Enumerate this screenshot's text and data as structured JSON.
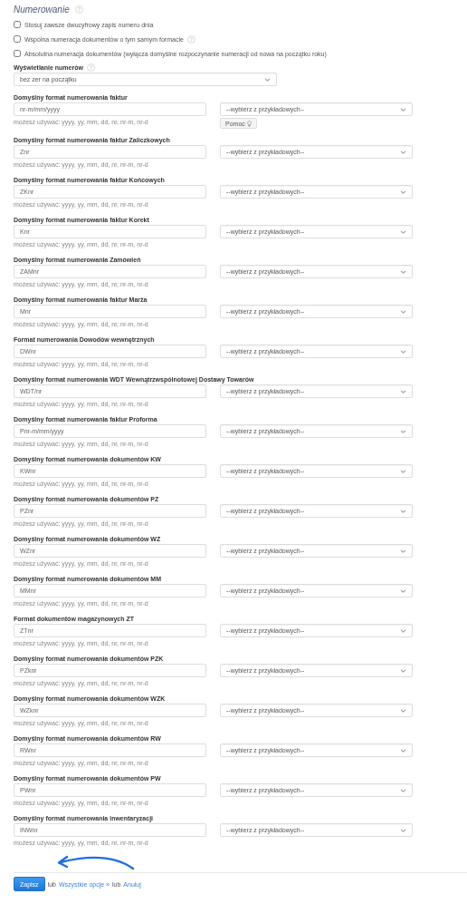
{
  "section": {
    "title": "Numerowanie",
    "help": true
  },
  "options": [
    {
      "label": "Stosuj zawsze dwucyfrowy zapis numeru dnia",
      "checked": false,
      "help": false
    },
    {
      "label": "Wspólna numeracja dokumentów o tym samym formacie",
      "checked": false,
      "help": true
    },
    {
      "label": "Absolutna numeracja dokumentów (wyłącza domyślne rozpoczynanie numeracji od nowa na początku roku)",
      "checked": false,
      "help": false
    }
  ],
  "display": {
    "label": "Wyświetlanie numerów",
    "help": true,
    "value": "bez zer na początku"
  },
  "formats": [
    {
      "label": "Domyślny format numerowania faktur",
      "value": "nr-m/mm/yyyy",
      "select": "--wybierz z przykładowych--",
      "hint": "możesz używać: yyyy, yy, mm, dd, nr, nr-m, nr-d",
      "help_button": "Pomoc"
    },
    {
      "label": "Domyślny format numerowania faktur Zaliczkowych",
      "value": "Znr",
      "select": "--wybierz z przykładowych--",
      "hint": "możesz używać: yyyy, yy, mm, dd, nr, nr-m, nr-d"
    },
    {
      "label": "Domyślny format numerowania faktur Końcowych",
      "value": "ZKnr",
      "select": "--wybierz z przykładowych--",
      "hint": "możesz używać: yyyy, yy, mm, dd, nr, nr-m, nr-d"
    },
    {
      "label": "Domyślny format numerowania faktur Korekt",
      "value": "Knr",
      "select": "--wybierz z przykładowych--",
      "hint": "możesz używać: yyyy, yy, mm, dd, nr, nr-m, nr-d"
    },
    {
      "label": "Domyślny format numerowania Zamówień",
      "value": "ZAMnr",
      "select": "--wybierz z przykładowych--",
      "hint": "możesz używać: yyyy, yy, mm, dd, nr, nr-m, nr-d"
    },
    {
      "label": "Domyślny format numerowania faktur Marża",
      "value": "Mnr",
      "select": "--wybierz z przykładowych--",
      "hint": "możesz używać: yyyy, yy, mm, dd, nr, nr-m, nr-d"
    },
    {
      "label": "Format numerowania Dowodów wewnętrznych",
      "value": "DWnr",
      "select": "--wybierz z przykładowych--",
      "hint": "możesz używać: yyyy, yy, mm, dd, nr, nr-m, nr-d"
    },
    {
      "label": "Domyślny format numerowania WDT Wewnątrzwspólnotowej Dostawy Towarów",
      "value": "WDT/nr",
      "select": "--wybierz z przykładowych--",
      "hint": "możesz używać: yyyy, yy, mm, dd, nr, nr-m, nr-d"
    },
    {
      "label": "Domyślny format numerowania faktur Proforma",
      "value": "Pnr-m/mm/yyyy",
      "select": "--wybierz z przykładowych--",
      "hint": "możesz używać: yyyy, yy, mm, dd, nr, nr-m, nr-d"
    },
    {
      "label": "Domyślny format numerowania dokumentów KW",
      "value": "KWnr",
      "select": "--wybierz z przykładowych--",
      "hint": "możesz używać: yyyy, yy, mm, dd, nr, nr-m, nr-d"
    },
    {
      "label": "Domyślny format numerowania dokumentów PZ",
      "value": "PZnr",
      "select": "--wybierz z przykładowych--",
      "hint": "możesz używać: yyyy, yy, mm, dd, nr, nr-m, nr-d"
    },
    {
      "label": "Domyślny format numerowania dokumentów WZ",
      "value": "WZnr",
      "select": "--wybierz z przykładowych--",
      "hint": "możesz używać: yyyy, yy, mm, dd, nr, nr-m, nr-d"
    },
    {
      "label": "Domyślny format numerowania dokumentów MM",
      "value": "MMnr",
      "select": "--wybierz z przykładowych--",
      "hint": "możesz używać: yyyy, yy, mm, dd, nr, nr-m, nr-d"
    },
    {
      "label": "Format dokumentów magazynowych ZT",
      "value": "ZTnr",
      "select": "--wybierz z przykładowych--",
      "hint": "możesz używać: yyyy, yy, mm, dd, nr, nr-m, nr-d"
    },
    {
      "label": "Domyślny format numerowania dokumentów PZK",
      "value": "PZknr",
      "select": "--wybierz z przykładowych--",
      "hint": "możesz używać: yyyy, yy, mm, dd, nr, nr-m, nr-d"
    },
    {
      "label": "Domyślny format numerowania dokumentów WZK",
      "value": "WZknr",
      "select": "--wybierz z przykładowych--",
      "hint": "możesz używać: yyyy, yy, mm, dd, nr, nr-m, nr-d"
    },
    {
      "label": "Domyślny format numerowania dokumentów RW",
      "value": "RWnr",
      "select": "--wybierz z przykładowych--",
      "hint": "możesz używać: yyyy, yy, mm, dd, nr, nr-m, nr-d"
    },
    {
      "label": "Domyślny format numerowania dokumentów PW",
      "value": "PWnr",
      "select": "--wybierz z przykładowych--",
      "hint": "możesz używać: yyyy, yy, mm, dd, nr, nr-m, nr-d"
    },
    {
      "label": "Domyślny format numerowania inwentaryzacji",
      "value": "INWnr",
      "select": "--wybierz z przykładowych--",
      "hint": "możesz używać: yyyy, yy, mm, dd, nr, nr-m, nr-d"
    }
  ],
  "footer": {
    "save": "Zapisz",
    "or_1": "lub",
    "all_options": "Wszystkie opcje »",
    "or_2": "lub",
    "cancel": "Anuluj"
  }
}
